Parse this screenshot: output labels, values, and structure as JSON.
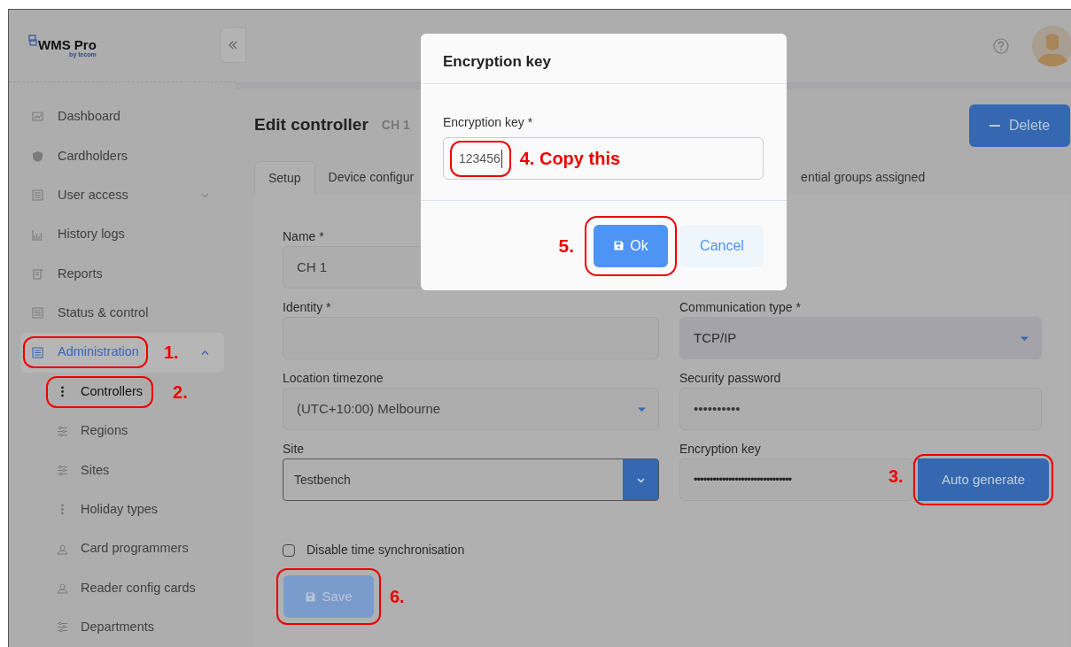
{
  "header": {
    "logo": {
      "name": "WMS Pro",
      "byline": "by tecom"
    }
  },
  "sidebar": {
    "items": [
      {
        "label": "Dashboard",
        "selected": false
      },
      {
        "label": "Cardholders",
        "selected": false
      },
      {
        "label": "User access",
        "selected": false,
        "expanded": false
      },
      {
        "label": "History logs",
        "selected": false
      },
      {
        "label": "Reports",
        "selected": false
      },
      {
        "label": "Status & control",
        "selected": false
      },
      {
        "label": "Administration",
        "selected": true,
        "expanded": true,
        "step": "1.",
        "children": [
          {
            "label": "Controllers",
            "selected": true,
            "step": "2."
          },
          {
            "label": "Regions",
            "selected": false
          },
          {
            "label": "Sites",
            "selected": false
          },
          {
            "label": "Holiday types",
            "selected": false
          },
          {
            "label": "Card programmers",
            "selected": false
          },
          {
            "label": "Reader config cards",
            "selected": false
          },
          {
            "label": "Departments",
            "selected": false
          }
        ]
      }
    ]
  },
  "page": {
    "title": "Edit controller",
    "subtitle": "CH 1",
    "delete_button": "Delete"
  },
  "tabs": [
    {
      "label": "Setup",
      "selected": true
    },
    {
      "label": "Device configur",
      "selected": false
    },
    {
      "label": "ential groups assigned",
      "selected": false
    }
  ],
  "form": {
    "left_fields": [
      {
        "kind": "text",
        "label": "Name *",
        "value": "CH 1"
      },
      {
        "kind": "text",
        "label": "Identity *"
      },
      {
        "kind": "select",
        "label": "Location timezone",
        "value": "(UTC+10:00) Melbourne"
      },
      {
        "kind": "select_addon",
        "label": "Site",
        "value": "Testbench"
      }
    ],
    "right_fields": [
      {
        "kind": "select",
        "label": "Communication type *",
        "value": "TCP/IP",
        "disabled": true
      },
      {
        "kind": "text",
        "label": "Security password",
        "value": "••••••••••"
      },
      {
        "kind": "text_button",
        "label": "Encryption key",
        "value": "•••••••••••••••••••••••••••••••",
        "button": "Auto generate",
        "step": "3."
      }
    ],
    "checkbox": {
      "label": "Disable time synchronisation",
      "checked": false
    },
    "save": {
      "label": "Save",
      "disabled": true,
      "step": "6."
    }
  },
  "modal": {
    "title": "Encryption key",
    "field": {
      "label": "Encryption key *",
      "value": "123456",
      "step": "4. Copy this"
    },
    "buttons": [
      {
        "kind": "primary",
        "label": "Ok",
        "step": "5."
      },
      {
        "kind": "secondary",
        "label": "Cancel"
      }
    ]
  }
}
